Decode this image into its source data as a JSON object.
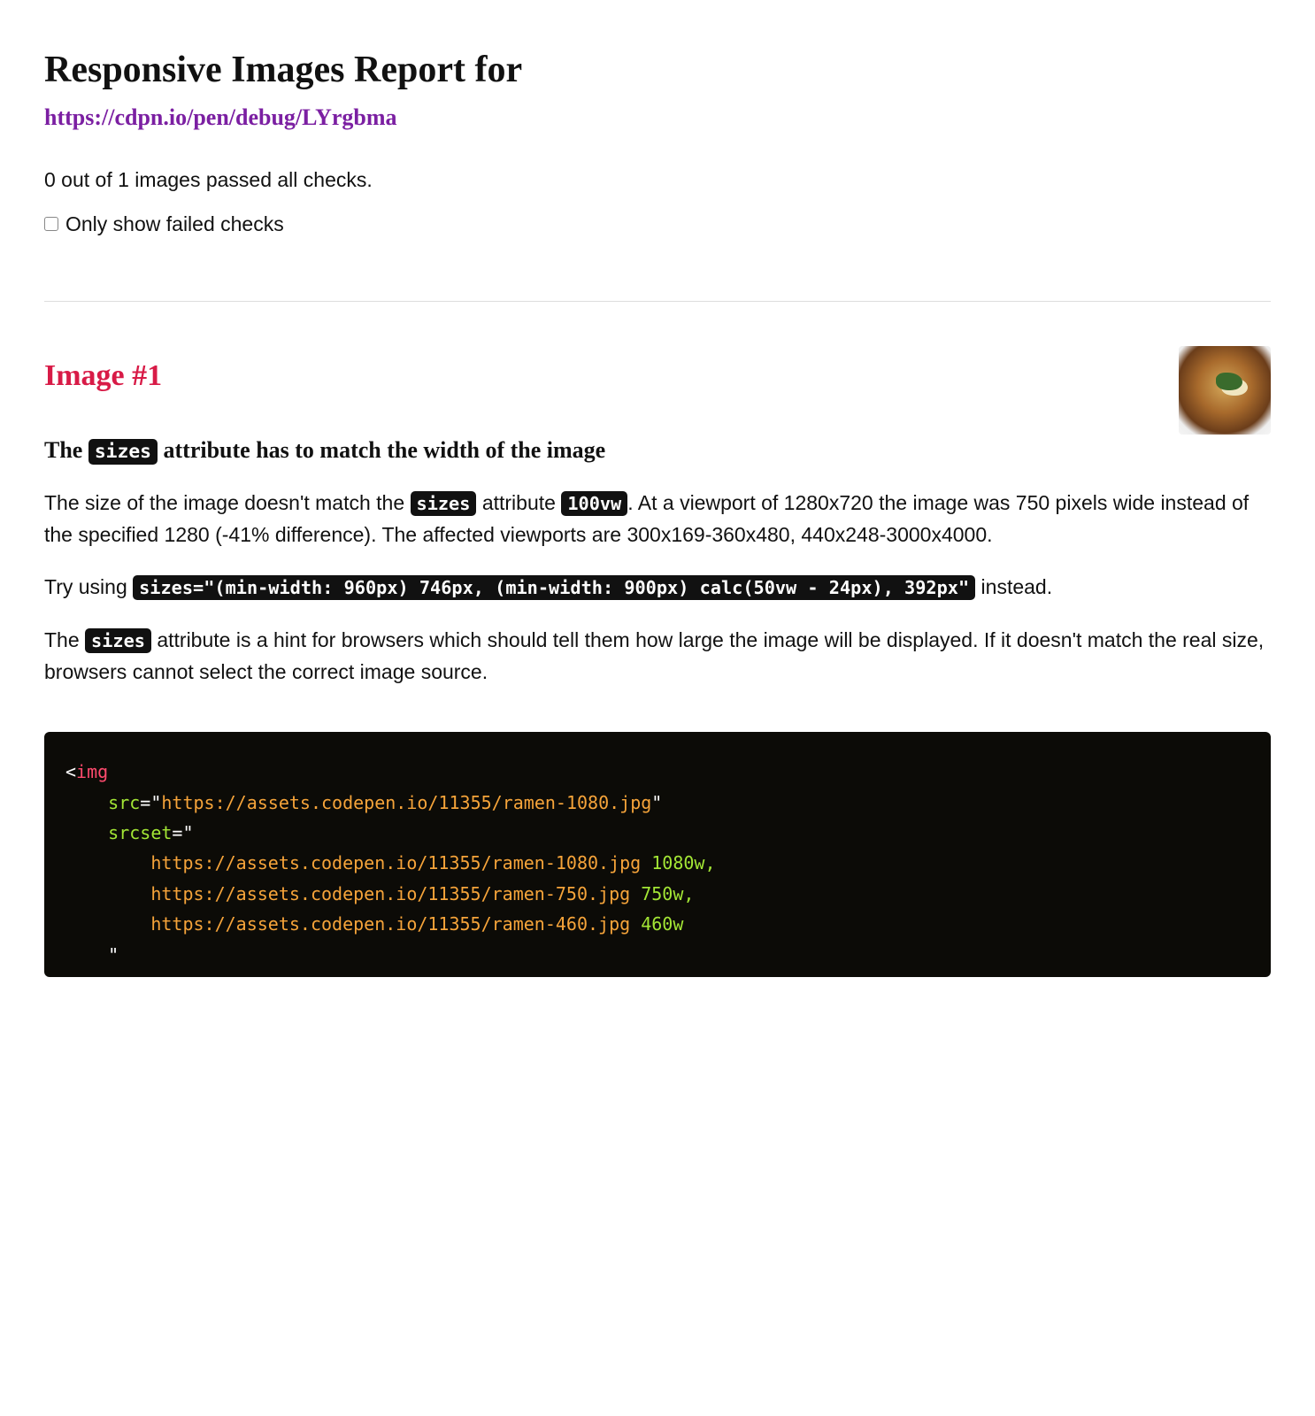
{
  "header": {
    "title": "Responsive Images Report for",
    "url": "https://cdpn.io/pen/debug/LYrgbma"
  },
  "summary": {
    "text": "0 out of 1 images passed all checks.",
    "checkbox_label": "Only show failed checks"
  },
  "image": {
    "heading": "Image #1",
    "thumb_alt": "ramen-thumbnail"
  },
  "check": {
    "title_pre": "The ",
    "title_code": "sizes",
    "title_post": " attribute has to match the width of the image",
    "para1_pre": "The size of the image doesn't match the ",
    "para1_code1": "sizes",
    "para1_mid": " attribute ",
    "para1_code2": "100vw",
    "para1_post": ". At a viewport of 1280x720 the image was 750 pixels wide instead of the specified 1280 (-41% difference). The affected viewports are 300x169-360x480, 440x248-3000x4000.",
    "para2_pre": "Try using ",
    "para2_code": "sizes=\"(min-width: 960px) 746px, (min-width: 900px) calc(50vw - 24px), 392px\"",
    "para2_post": " instead.",
    "para3_pre": "The ",
    "para3_code": "sizes",
    "para3_post": " attribute is a hint for browsers which should tell them how large the image will be displayed. If it doesn't match the real size, browsers cannot select the correct image source."
  },
  "codeblock": {
    "tag_open": "<",
    "tag_name": "img",
    "attr_src": "src",
    "attr_srcset": "srcset",
    "eq": "=",
    "q": "\"",
    "src_url": "https://assets.codepen.io/11355/ramen-1080.jpg",
    "srcset_line1_url": "https://assets.codepen.io/11355/ramen-1080.jpg",
    "srcset_line1_w": " 1080w,",
    "srcset_line2_url": "https://assets.codepen.io/11355/ramen-750.jpg",
    "srcset_line2_w": " 750w,",
    "srcset_line3_url": "https://assets.codepen.io/11355/ramen-460.jpg",
    "srcset_line3_w": " 460w"
  }
}
